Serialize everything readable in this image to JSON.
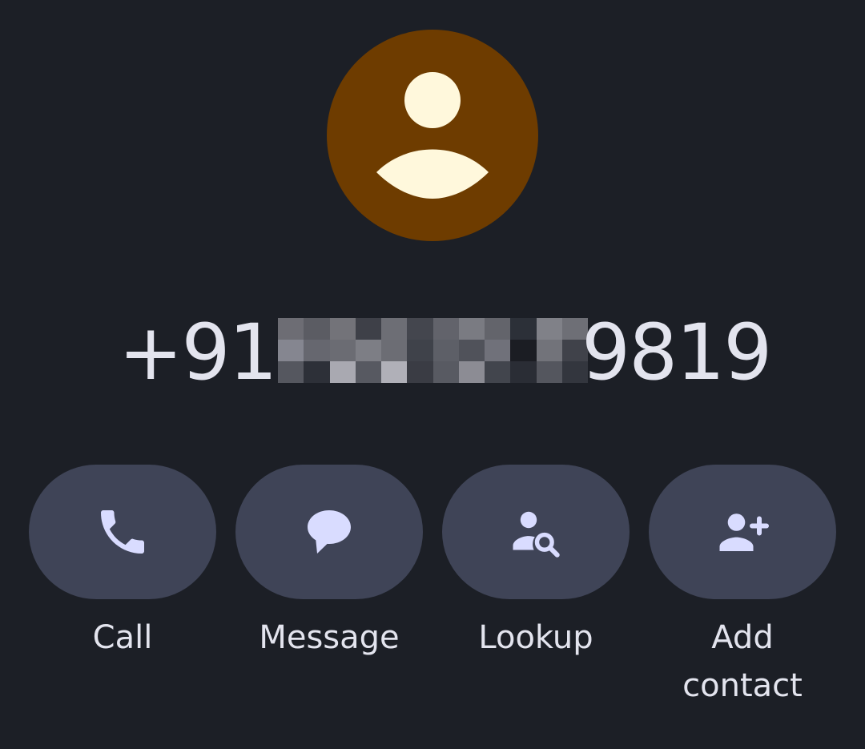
{
  "contact": {
    "avatar_icon": "person-icon",
    "avatar_color": "#6e3c00",
    "avatar_glyph_color": "#fff8dc",
    "phone_prefix": "+91 9",
    "phone_suffix": "9819",
    "phone_redacted": true
  },
  "actions": [
    {
      "label": "Call",
      "icon": "phone-icon"
    },
    {
      "label": "Message",
      "icon": "chat-bubble-icon"
    },
    {
      "label": "Lookup",
      "icon": "person-search-icon"
    },
    {
      "label": "Add contact",
      "icon": "person-add-icon"
    }
  ],
  "colors": {
    "background": "#1c1f26",
    "button": "#3f4457",
    "text": "#e3e4ee",
    "icon": "#d9dcff"
  }
}
